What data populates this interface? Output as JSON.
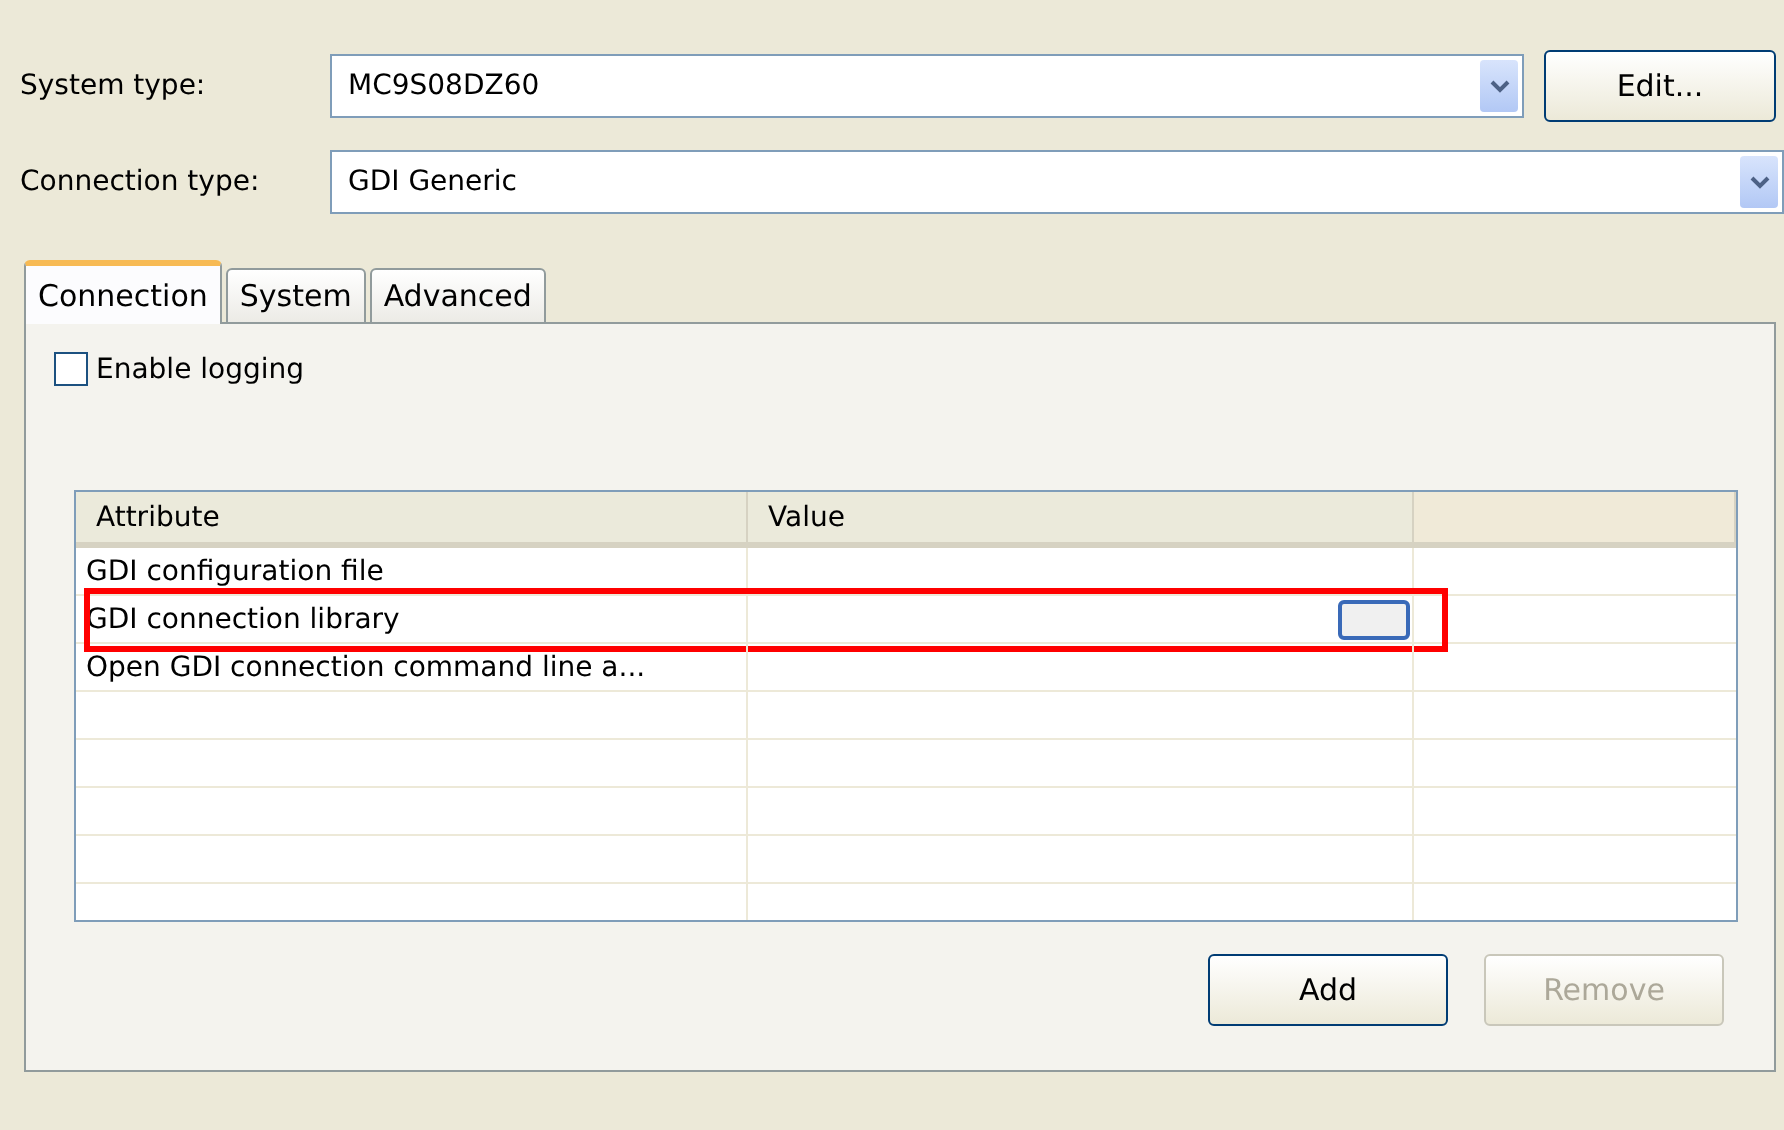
{
  "system_type": {
    "label": "System type:",
    "value": "MC9S08DZ60"
  },
  "edit_button": {
    "label": "Edit..."
  },
  "connection_type": {
    "label": "Connection type:",
    "value": "GDI Generic"
  },
  "tabs": [
    {
      "label": "Connection",
      "selected": true
    },
    {
      "label": "System",
      "selected": false
    },
    {
      "label": "Advanced",
      "selected": false
    }
  ],
  "enable_logging": {
    "label": "Enable logging",
    "checked": false
  },
  "table": {
    "columns": [
      "Attribute",
      "Value"
    ],
    "rows": [
      {
        "attribute": "GDI configuration file",
        "browse": false,
        "highlighted": false
      },
      {
        "attribute": "GDI connection library",
        "browse": true,
        "highlighted": true
      },
      {
        "attribute": "Open GDI connection command line a...",
        "browse": false,
        "highlighted": false
      }
    ]
  },
  "buttons": [
    {
      "label": "Add",
      "disabled": false
    },
    {
      "label": "Remove",
      "disabled": true
    }
  ]
}
